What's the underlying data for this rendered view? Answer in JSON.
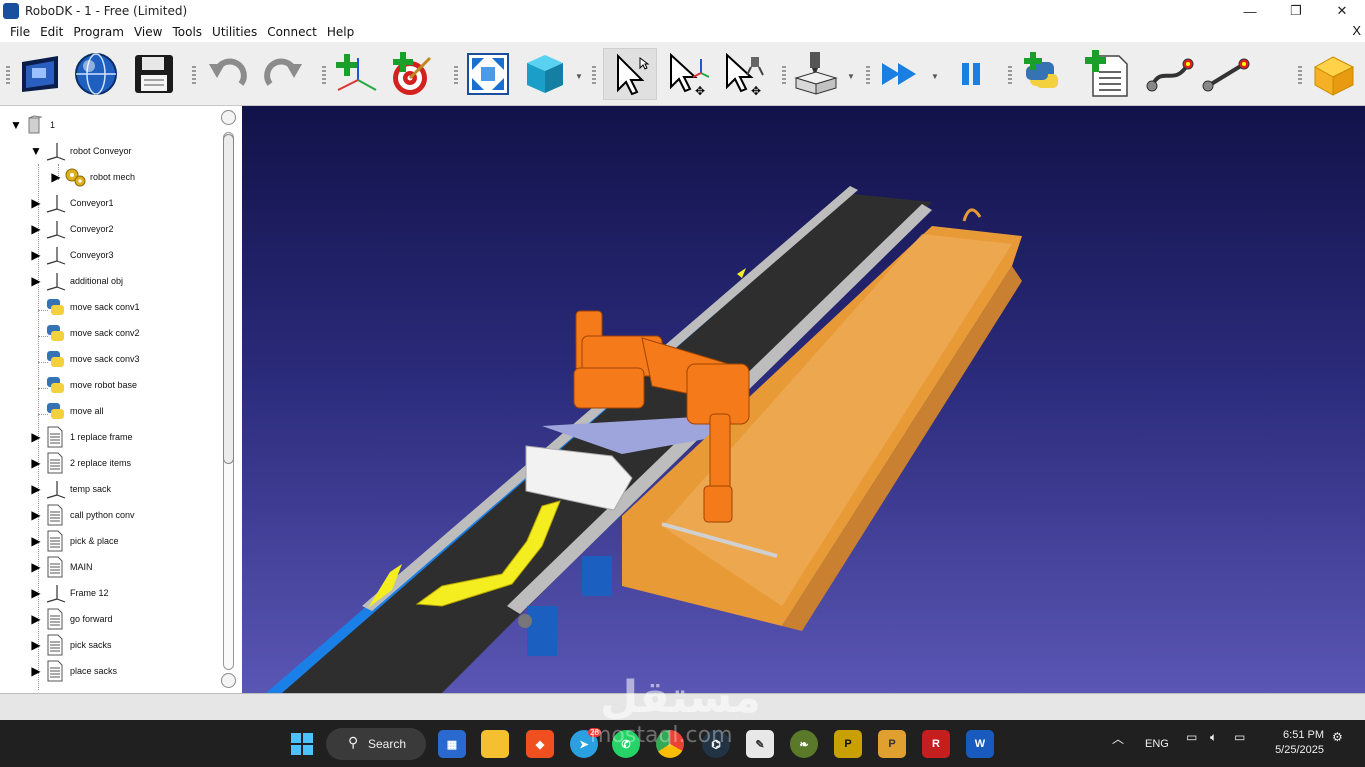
{
  "window": {
    "title": "RoboDK - 1 - Free (Limited)",
    "minimize_glyph": "—",
    "maximize_glyph": "❐",
    "close_glyph": "✕"
  },
  "menu": {
    "items": [
      "File",
      "Edit",
      "Program",
      "View",
      "Tools",
      "Utilities",
      "Connect",
      "Help"
    ],
    "close_glyph": "X"
  },
  "toolbar": {
    "buttons": [
      {
        "name": "open-icon"
      },
      {
        "name": "online-library-icon"
      },
      {
        "name": "save-icon"
      },
      {
        "name": "undo-icon"
      },
      {
        "name": "redo-icon"
      },
      {
        "name": "add-reference-frame-icon"
      },
      {
        "name": "add-target-icon"
      },
      {
        "name": "fit-all-icon"
      },
      {
        "name": "view-3d-icon"
      },
      {
        "name": "select-icon"
      },
      {
        "name": "move-reference-icon"
      },
      {
        "name": "move-tool-icon"
      },
      {
        "name": "machining-project-icon"
      },
      {
        "name": "run-simulation-icon"
      },
      {
        "name": "pause-icon"
      },
      {
        "name": "add-python-program-icon"
      },
      {
        "name": "add-program-icon"
      },
      {
        "name": "move-joint-icon"
      },
      {
        "name": "move-linear-icon"
      },
      {
        "name": "add-ons-icon"
      }
    ]
  },
  "tree": {
    "root": "1",
    "items": [
      {
        "label": "robot Conveyor",
        "icon": "frame",
        "expanded": true,
        "level": 1
      },
      {
        "label": "robot mech",
        "icon": "gears",
        "expanded": false,
        "level": 2
      },
      {
        "label": "Conveyor1",
        "icon": "frame",
        "expanded": false,
        "level": 1
      },
      {
        "label": "Conveyor2",
        "icon": "frame",
        "expanded": false,
        "level": 1
      },
      {
        "label": "Conveyor3",
        "icon": "frame",
        "expanded": false,
        "level": 1
      },
      {
        "label": "additional obj",
        "icon": "frame",
        "expanded": false,
        "level": 1
      },
      {
        "label": "move sack conv1",
        "icon": "python",
        "level": 1,
        "leaf": true
      },
      {
        "label": "move sack conv2",
        "icon": "python",
        "level": 1,
        "leaf": true
      },
      {
        "label": "move sack conv3",
        "icon": "python",
        "level": 1,
        "leaf": true
      },
      {
        "label": "move robot base",
        "icon": "python",
        "level": 1,
        "leaf": true
      },
      {
        "label": "move all",
        "icon": "python",
        "level": 1,
        "leaf": true
      },
      {
        "label": "1 replace frame",
        "icon": "program",
        "expanded": false,
        "level": 1
      },
      {
        "label": "2 replace items",
        "icon": "program",
        "expanded": false,
        "level": 1
      },
      {
        "label": "temp sack",
        "icon": "frame",
        "expanded": false,
        "level": 1
      },
      {
        "label": "call python conv",
        "icon": "program",
        "expanded": false,
        "level": 1
      },
      {
        "label": "pick & place",
        "icon": "program",
        "expanded": false,
        "level": 1
      },
      {
        "label": "MAIN",
        "icon": "program",
        "expanded": false,
        "level": 1
      },
      {
        "label": "Frame 12",
        "icon": "frame",
        "expanded": false,
        "level": 1
      },
      {
        "label": "go forward",
        "icon": "program",
        "expanded": false,
        "level": 1
      },
      {
        "label": "pick sacks",
        "icon": "program",
        "expanded": false,
        "level": 1
      },
      {
        "label": "place sacks",
        "icon": "program",
        "expanded": false,
        "level": 1
      }
    ]
  },
  "taskbar": {
    "search_label": "Search",
    "telegram_badge": "28",
    "lang": "ENG",
    "time": "6:51 PM",
    "date": "5/25/2025",
    "apps": [
      "windows-start-icon",
      "search",
      "widgets-icon",
      "file-explorer-icon",
      "brave-icon",
      "telegram-icon",
      "whatsapp-icon",
      "chrome-icon",
      "robodk-icon",
      "notepad-icon",
      "app-icon",
      "sketchup-icon",
      "powerpoint-icon",
      "revit-icon",
      "word-icon"
    ]
  },
  "watermark": {
    "arabic": "مستقل",
    "latin": "mostaql.com"
  }
}
